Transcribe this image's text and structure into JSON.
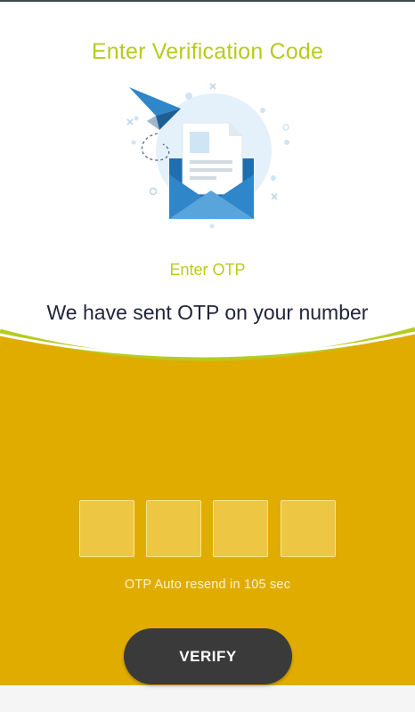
{
  "header": {
    "title": "Enter Verification Code"
  },
  "illustration": {
    "icon": "envelope-with-paper-plane-icon"
  },
  "otp": {
    "heading": "Enter OTP",
    "message": "We have sent OTP on your number",
    "boxes": [
      "",
      "",
      "",
      ""
    ],
    "resend_text": "OTP Auto resend in 105 sec"
  },
  "actions": {
    "verify_label": "VERIFY"
  },
  "colors": {
    "accent": "#b7cb1f",
    "panel": "#e0ac00",
    "button": "#3a3a3a",
    "envelope": "#2f86c9"
  }
}
